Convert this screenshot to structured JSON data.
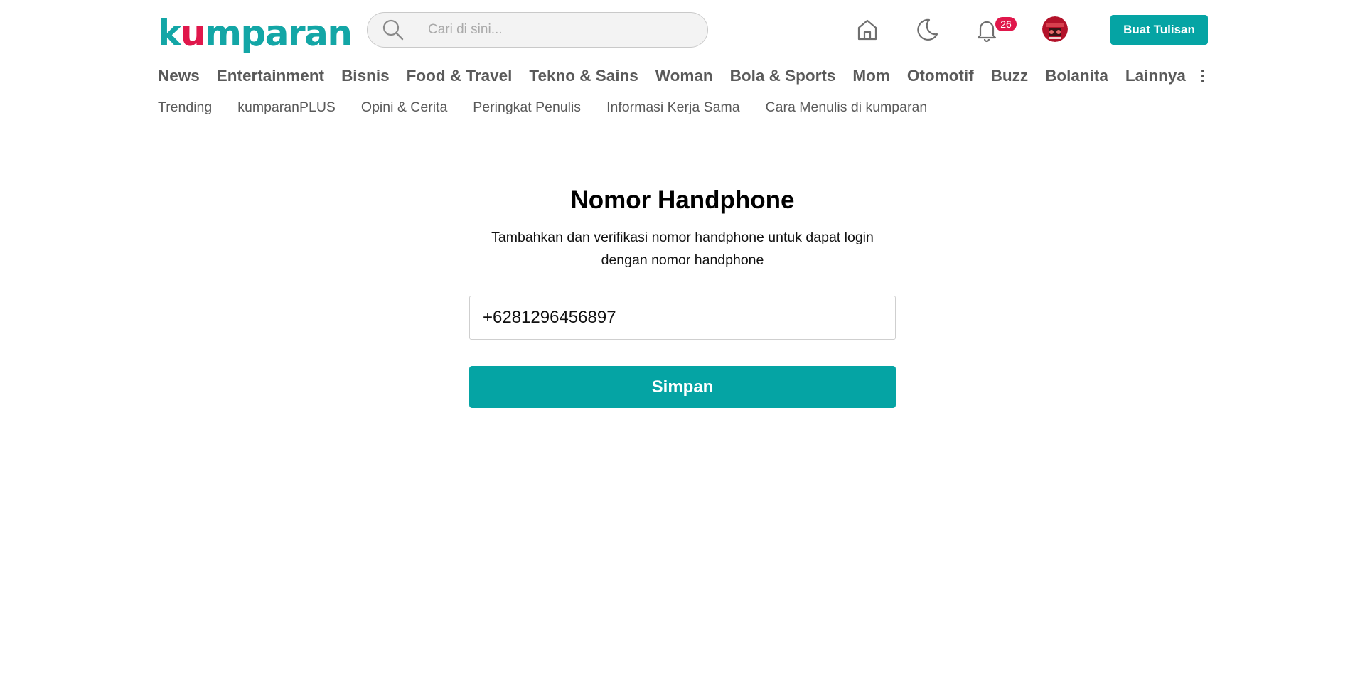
{
  "header": {
    "logo": {
      "pre": "k",
      "u": "u",
      "post": "mparan"
    },
    "search": {
      "placeholder": "Cari di sini...",
      "value": ""
    },
    "icons": [
      "home-icon",
      "moon-icon",
      "bell-icon"
    ],
    "notification_count": "26",
    "write_button": "Buat Tulisan"
  },
  "nav": {
    "main": [
      "News",
      "Entertainment",
      "Bisnis",
      "Food & Travel",
      "Tekno & Sains",
      "Woman",
      "Bola & Sports",
      "Mom",
      "Otomotif",
      "Buzz",
      "Bolanita",
      "Lainnya"
    ],
    "sub": [
      "Trending",
      "kumparanPLUS",
      "Opini & Cerita",
      "Peringkat Penulis",
      "Informasi Kerja Sama",
      "Cara Menulis di kumparan"
    ]
  },
  "form": {
    "title": "Nomor Handphone",
    "description": "Tambahkan dan verifikasi nomor handphone untuk dapat login dengan nomor handphone",
    "phone_value": "+6281296456897",
    "save_label": "Simpan"
  },
  "colors": {
    "brand": "#05a4a4",
    "accent": "#e0174b",
    "nav_text": "#5a5a5a"
  }
}
